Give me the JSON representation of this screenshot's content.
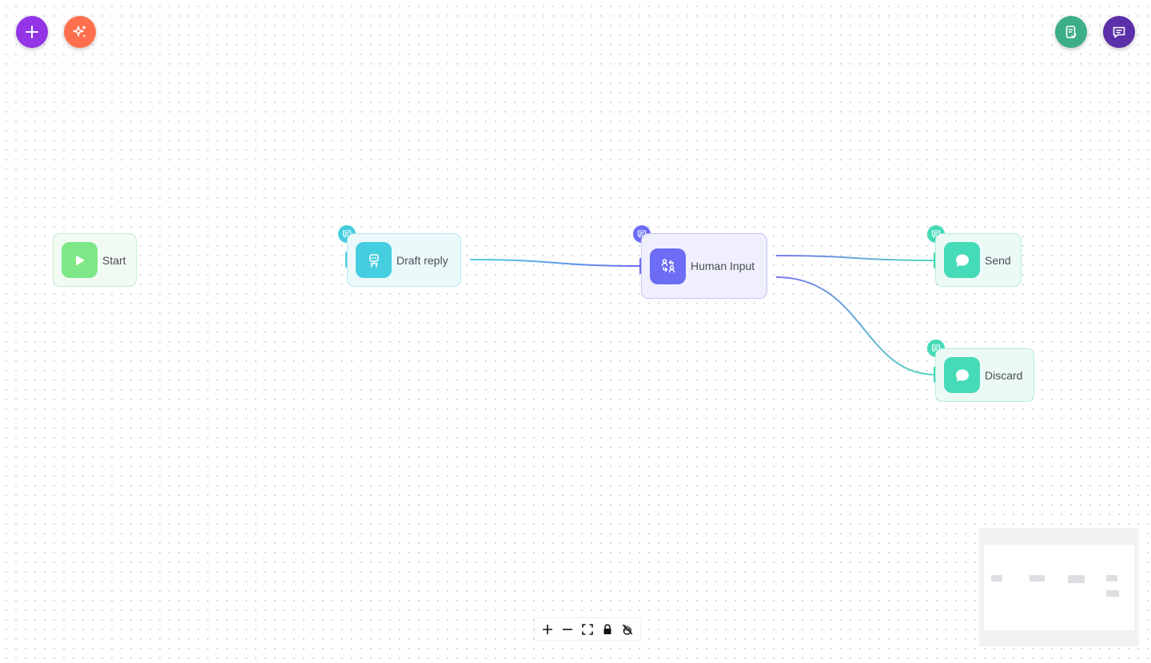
{
  "toolbar": {
    "add_icon": "plus-icon",
    "ai_icon": "sparkles-icon",
    "checklist_icon": "clipboard-check-icon",
    "chat_icon": "chat-icon"
  },
  "nodes": {
    "start": {
      "label": "Start",
      "icon": "play-icon",
      "color": "#7ee787"
    },
    "draft": {
      "label": "Draft reply",
      "icon": "robot-icon",
      "color": "#45cde0"
    },
    "human": {
      "label": "Human Input",
      "icon": "human-swap-icon",
      "color": "#6c6cf5"
    },
    "send": {
      "label": "Send",
      "icon": "message-bubble-icon",
      "color": "#46dbb8"
    },
    "discard": {
      "label": "Discard",
      "icon": "message-bubble-icon",
      "color": "#46dbb8"
    }
  },
  "controls": {
    "zoom_in": "plus-icon",
    "zoom_out": "minus-icon",
    "fit_view": "fit-view-icon",
    "lock": "lock-icon",
    "interaction": "pointer-icon"
  },
  "colors": {
    "add": "#9334e6",
    "ai": "#ff6f4e",
    "checklist": "#3dae85",
    "chat": "#5b2fa8"
  }
}
